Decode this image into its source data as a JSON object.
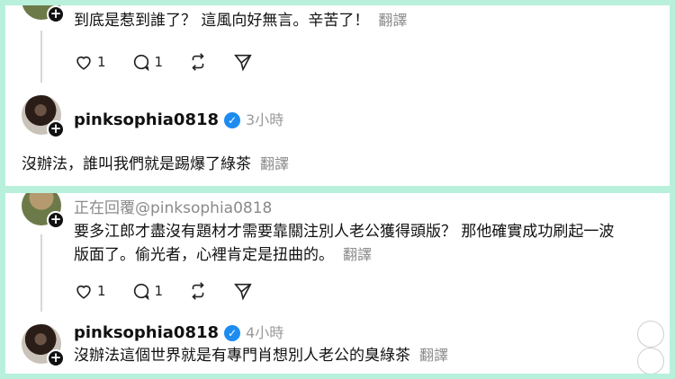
{
  "post1": {
    "text": "到底是惹到誰了？ 這風向好無言。辛苦了！",
    "translate_label": "翻譯",
    "like_count": "1",
    "comment_count": "1"
  },
  "reply1": {
    "username": "pinksophia0818",
    "time": "3小時",
    "text": "沒辦法，誰叫我們就是踢爆了綠茶",
    "translate_label": "翻譯"
  },
  "post2": {
    "replying_to": "正在回覆@pinksophia0818",
    "line1": "要多江郎才盡沒有題材才需要靠關注別人老公獲得頭版？ 那他確實成功刷起一波",
    "line2": "版面了。偷光者，心裡肯定是扭曲的。",
    "translate_label": "翻譯",
    "like_count": "1",
    "comment_count": "1"
  },
  "reply2": {
    "username": "pinksophia0818",
    "time": "4小時",
    "text": "沒辦法這個世界就是有專門肖想別人老公的臭綠茶",
    "translate_label": "翻譯"
  },
  "icons": {
    "verified": "✓",
    "plus": "+"
  },
  "colors": {
    "frame": "#b8f0dc",
    "verified": "#1d8cf0",
    "muted": "#8a8a8a"
  }
}
